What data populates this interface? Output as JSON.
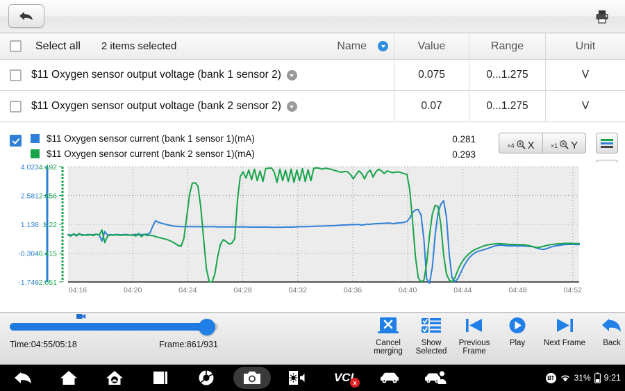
{
  "toolbar": {
    "back_icon": "back-arrow-icon",
    "print_icon": "printer-icon"
  },
  "table": {
    "select_all_label": "Select all",
    "selected_count_label": "2 items selected",
    "headers": {
      "name": "Name",
      "value": "Value",
      "range": "Range",
      "unit": "Unit"
    },
    "sort_icon": "sort-descending-circle-icon",
    "rows": [
      {
        "name": "$11 Oxygen sensor output voltage (bank 1 sensor 2)",
        "value": "0.075",
        "range": "0...1.275",
        "unit": "V",
        "checked": false
      },
      {
        "name": "$11 Oxygen sensor output voltage (bank 2 sensor 2)",
        "value": "0.07",
        "range": "0...1.275",
        "unit": "V",
        "checked": false
      }
    ]
  },
  "graph": {
    "checked": true,
    "series_legend": [
      {
        "label": "$11 Oxygen sensor current (bank 1 sensor 1)(mA)",
        "value": "0.281",
        "color": "#2f7fd8"
      },
      {
        "label": "$11 Oxygen sensor current (bank 2 sensor 1)(mA)",
        "value": "0.293",
        "color": "#17a34a"
      }
    ],
    "zoom_x": {
      "multiplier": "×4",
      "axis": "X",
      "icon": "magnifier-icon"
    },
    "zoom_y": {
      "multiplier": "×1",
      "axis": "Y",
      "icon": "magnifier-icon"
    },
    "side_buttons": [
      {
        "name": "chart-list-menu-button",
        "icon": "list-lines-icon"
      },
      {
        "name": "fullscreen-button",
        "icon": "expand-arrows-icon"
      },
      {
        "name": "close-graph-button",
        "icon": "close-x-icon"
      }
    ]
  },
  "chart_data": {
    "type": "line",
    "title": "",
    "xlabel": "",
    "ylabel": "",
    "grid": true,
    "legend_position": "top",
    "x_ticks": [
      "04:16",
      "04:20",
      "04:24",
      "04:28",
      "04:32",
      "04:36",
      "04:40",
      "04:44",
      "04:48",
      "04:52"
    ],
    "axes": [
      {
        "name": "blue-axis",
        "color": "#2f7fd8",
        "ticks": [
          "4.023",
          "2.581",
          "1.138",
          "-0.304",
          "-1.746"
        ],
        "ylim": [
          -1.746,
          4.023
        ]
      },
      {
        "name": "green-axis",
        "color": "#17a34a",
        "ticks": [
          "4.492",
          "2.856",
          "1.22",
          "-0.415",
          "-2.051"
        ],
        "ylim": [
          -2.051,
          4.492
        ]
      }
    ],
    "series": [
      {
        "name": "$11 Oxygen sensor current (bank 1 sensor 1)(mA)",
        "color": "#2f7fd8",
        "axis": "blue-axis",
        "current_value": 0.281,
        "values": [
          0.62,
          0.6,
          0.63,
          0.61,
          0.64,
          0.62,
          0.6,
          0.63,
          0.61,
          0.62,
          0.64,
          0.61,
          0.3,
          0.78,
          0.6,
          0.62,
          0.61,
          0.63,
          0.62,
          0.61,
          0.63,
          0.62,
          0.6,
          0.62,
          0.63,
          0.61,
          0.62,
          0.63,
          0.64,
          0.7,
          1.05,
          1.32,
          1.24,
          1.2,
          1.16,
          1.12,
          1.09,
          1.06,
          1.04,
          1.03,
          1.02,
          1.02,
          1.02,
          1.02,
          1.02,
          1.02,
          1.02,
          1.02,
          1.02,
          1.02,
          1.02,
          1.02,
          1.02,
          1.01,
          1.01,
          1.01,
          1.01,
          1.01,
          1.01,
          1.01,
          1.01,
          1.01,
          1.01,
          1.01,
          1.0,
          1.0,
          1.0,
          1.0,
          1.0,
          1.0,
          1.0,
          1.0,
          0.99,
          0.99,
          0.99,
          0.99,
          0.99,
          1.0,
          1.0,
          1.0,
          1.01,
          1.01,
          1.02,
          1.02,
          1.02,
          1.03,
          1.03,
          1.04,
          1.04,
          1.05,
          1.05,
          1.06,
          1.06,
          1.07,
          1.07,
          1.08,
          1.09,
          1.1,
          1.1,
          1.11,
          1.12,
          1.12,
          1.13,
          1.13,
          1.1,
          1.12,
          1.15,
          1.14,
          1.16,
          1.17,
          1.18,
          1.18,
          1.19,
          1.2,
          1.2,
          1.17,
          1.19,
          1.21,
          1.22,
          1.24,
          1.28,
          1.45,
          1.72,
          1.86,
          1.88,
          1.6,
          0.4,
          -1.6,
          -1.85,
          -1.0,
          0.6,
          1.7,
          2.15,
          2.32,
          1.5,
          -0.4,
          -1.55,
          -1.72,
          -1.6,
          -1.3,
          -1.0,
          -0.75,
          -0.55,
          -0.4,
          -0.3,
          -0.22,
          -0.18,
          -0.14,
          -0.1,
          -0.05,
          0.0,
          0.05,
          0.08,
          0.1,
          0.09,
          0.07,
          0.06,
          0.06,
          0.06,
          0.06,
          0.06,
          0.05,
          0.05,
          0.04,
          0.03,
          0.0,
          -0.05,
          -0.09,
          -0.12,
          -0.1,
          -0.05,
          0.0,
          0.04,
          0.07,
          0.09,
          0.11,
          0.12,
          0.13,
          0.13,
          0.13,
          0.12,
          0.12
        ]
      },
      {
        "name": "$11 Oxygen sensor current (bank 2 sensor 1)(mA)",
        "color": "#17a34a",
        "axis": "green-axis",
        "current_value": 0.293,
        "values": [
          0.62,
          0.55,
          0.68,
          0.56,
          0.7,
          0.58,
          0.62,
          0.6,
          0.64,
          0.58,
          0.66,
          0.6,
          0.9,
          0.18,
          0.55,
          0.62,
          0.6,
          0.63,
          0.61,
          0.6,
          0.62,
          0.61,
          0.6,
          0.62,
          0.55,
          0.7,
          0.52,
          0.66,
          0.58,
          0.6,
          0.58,
          0.52,
          0.48,
          0.44,
          0.4,
          0.36,
          0.3,
          0.22,
          0.12,
          0.02,
          -0.02,
          0.4,
          1.6,
          2.9,
          3.55,
          3.58,
          3.4,
          2.2,
          0.4,
          -1.3,
          -2.05,
          -2.05,
          -1.6,
          -0.6,
          0.1,
          0.35,
          0.25,
          0.1,
          0.15,
          0.4,
          2.6,
          3.95,
          4.2,
          3.85,
          4.3,
          3.75,
          4.35,
          3.7,
          4.25,
          3.65,
          4.38,
          4.4,
          4.42,
          4.2,
          3.6,
          4.35,
          3.7,
          4.3,
          3.65,
          4.35,
          3.6,
          4.3,
          3.7,
          4.38,
          3.65,
          4.32,
          3.7,
          4.4,
          4.42,
          4.4,
          4.35,
          4.4,
          4.38,
          4.35,
          4.3,
          4.25,
          4.2,
          4.18,
          4.22,
          4.2,
          4.05,
          3.8,
          4.05,
          4.25,
          4.1,
          3.8,
          4.15,
          4.3,
          3.9,
          4.2,
          4.35,
          4.25,
          4.1,
          4.25,
          4.2,
          4.15,
          4.18,
          4.2,
          4.15,
          4.1,
          4.05,
          3.2,
          1.4,
          -0.6,
          -1.8,
          -2.05,
          -1.95,
          -1.0,
          0.6,
          1.8,
          2.3,
          2.25,
          1.2,
          -0.5,
          -1.6,
          -1.95,
          -2.05,
          -1.8,
          -1.4,
          -1.05,
          -0.8,
          -0.6,
          -0.45,
          -0.32,
          -0.22,
          -0.15,
          -0.08,
          -0.02,
          0.03,
          0.06,
          0.09,
          0.11,
          0.12,
          0.12,
          0.11,
          0.1,
          0.09,
          0.08,
          0.08,
          0.07,
          0.07,
          0.06,
          0.05,
          0.02,
          -0.02,
          -0.06,
          -0.1,
          -0.08,
          -0.04,
          0.0,
          0.04,
          0.07,
          0.09,
          0.11,
          0.12,
          0.13,
          0.14,
          0.14,
          0.14,
          0.13,
          0.13,
          0.13
        ]
      }
    ]
  },
  "playback": {
    "time_label": "Time:04:55/05:18",
    "frame_label": "Frame:861/931",
    "slider_percent": 91,
    "camera_marker_icon": "video-camera-icon",
    "actions": [
      {
        "name": "cancel-merging-button",
        "label": "Cancel\nmerging",
        "label_line1": "Cancel",
        "label_line2": "merging",
        "icon": "cancel-x-icon"
      },
      {
        "name": "show-selected-button",
        "label_line1": "Show",
        "label_line2": "Selected",
        "icon": "checklist-icon"
      },
      {
        "name": "previous-frame-button",
        "label_line1": "Previous",
        "label_line2": "Frame",
        "icon": "skip-previous-icon"
      },
      {
        "name": "play-button",
        "label_line1": "Play",
        "label_line2": "",
        "icon": "play-circle-icon"
      },
      {
        "name": "next-frame-button",
        "label_line1": "Next Frame",
        "label_line2": "",
        "icon": "skip-next-icon"
      },
      {
        "name": "back-button",
        "label_line1": "Back",
        "label_line2": "",
        "icon": "back-arrow-icon"
      }
    ]
  },
  "navbar": {
    "items": [
      {
        "name": "nav-back",
        "icon": "back-arrow-icon",
        "active": false
      },
      {
        "name": "nav-home",
        "icon": "home-icon",
        "active": false
      },
      {
        "name": "nav-android-home",
        "icon": "android-house-icon",
        "active": false
      },
      {
        "name": "nav-recents",
        "icon": "square-recents-icon",
        "active": false
      },
      {
        "name": "nav-browser",
        "icon": "chrome-browser-icon",
        "active": false
      },
      {
        "name": "nav-screenshot",
        "icon": "camera-icon",
        "active": true
      },
      {
        "name": "nav-display",
        "icon": "brightness-volume-icon",
        "active": false
      },
      {
        "name": "nav-vci",
        "icon": "vci-disconnected-icon",
        "active": false
      },
      {
        "name": "nav-vehicle",
        "icon": "car-icon",
        "active": false
      },
      {
        "name": "nav-remote-assist",
        "icon": "car-technician-icon",
        "active": false
      }
    ],
    "vci_label": "VCI",
    "status": {
      "bt_label": "BT",
      "bt_icon": "bluetooth-icon",
      "wifi_icon": "wifi-icon",
      "battery_percent": "31%",
      "battery_icon": "battery-icon",
      "clock": "9:21"
    }
  }
}
